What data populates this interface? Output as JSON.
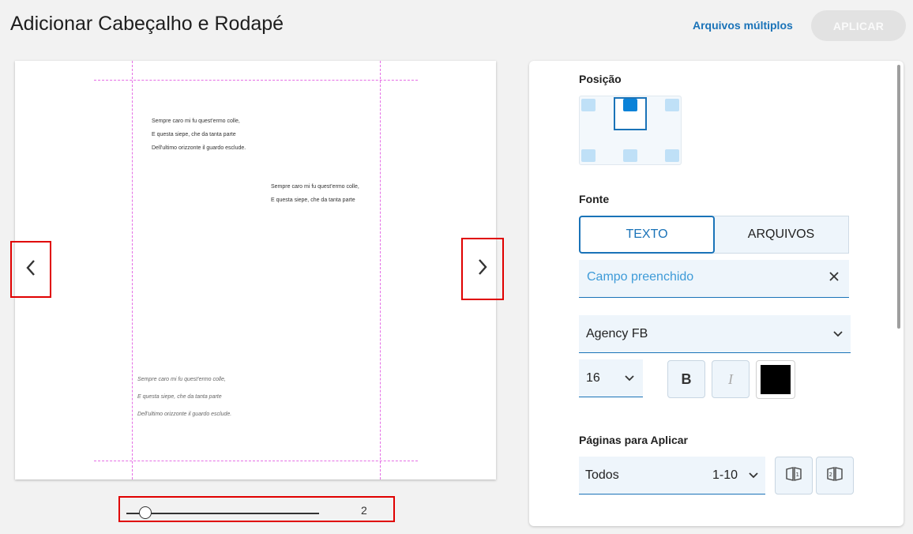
{
  "header": {
    "title": "Adicionar Cabeçalho e Rodapé",
    "multi_files_link": "Arquivos múltiplos",
    "apply_button": "APLICAR"
  },
  "preview": {
    "text_block_1": [
      "Sempre caro mi fu quest'ermo colle,",
      "E questa siepe, che da tanta parte",
      "Dell'ultimo orizzonte il guardo esclude."
    ],
    "text_block_2": [
      "Sempre caro mi fu quest'ermo colle,",
      "E questa siepe, che da tanta parte"
    ],
    "text_block_3": [
      "Sempre caro mi fu quest'ermo colle,",
      "E questa siepe, che da tanta parte",
      "Dell'ultimo orizzonte il guardo esclude."
    ],
    "prev_icon": "chevron-left-icon",
    "next_icon": "chevron-right-icon",
    "page_number": "2",
    "slider_fraction": 0.1
  },
  "panel": {
    "position_label": "Posição",
    "source_label": "Fonte",
    "source_tabs": [
      "TEXTO",
      "ARQUIVOS"
    ],
    "text_input": {
      "value": "Campo preenchido"
    },
    "font_family": "Agency FB",
    "font_size": "16",
    "bold_label": "B",
    "italic_label": "I",
    "text_color": "#000000",
    "pages_label": "Páginas para Aplicar",
    "pages_select": "Todos",
    "pages_range": "1-10"
  },
  "colors": {
    "accent": "#1a73b8",
    "guide": "#e56ee5",
    "highlight_border": "#e00000"
  }
}
